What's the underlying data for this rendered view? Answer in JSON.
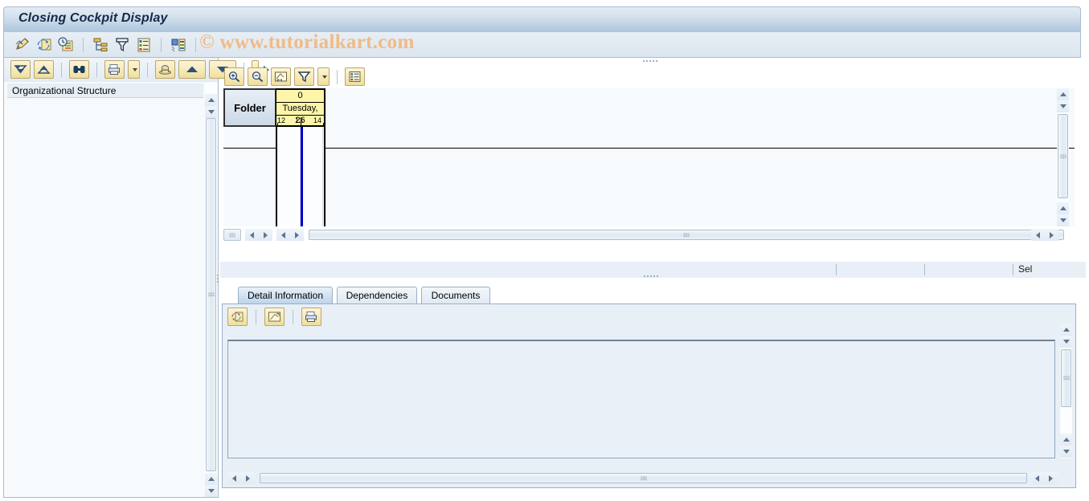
{
  "window": {
    "title": "Closing Cockpit Display"
  },
  "watermark": {
    "text": "© www.tutorialkart.com"
  },
  "main_toolbar": {
    "buttons": [
      {
        "name": "display-change-icon",
        "label": "Display/Change",
        "glyph": "pencil-ruler"
      },
      {
        "name": "refresh-icon",
        "label": "Refresh",
        "glyph": "refresh"
      },
      {
        "name": "schedule-icon",
        "label": "Schedule",
        "glyph": "clock-list"
      },
      {
        "name": "hierarchy-icon",
        "label": "Hierarchy",
        "glyph": "tree"
      },
      {
        "name": "filter-funnel-icon",
        "label": "Filter",
        "glyph": "funnel-box"
      },
      {
        "name": "detail-list-icon",
        "label": "Detail List",
        "glyph": "list"
      },
      {
        "name": "layout-icon",
        "label": "Layout",
        "glyph": "columns"
      }
    ]
  },
  "left_panel": {
    "toolbar": [
      {
        "name": "expand-all-button",
        "label": "Expand All",
        "glyph": "expand-down"
      },
      {
        "name": "collapse-all-button",
        "label": "Collapse All",
        "glyph": "collapse-up"
      },
      {
        "name": "find-button",
        "label": "Find",
        "glyph": "binoculars"
      },
      {
        "name": "print-button",
        "label": "Print",
        "glyph": "printer",
        "has_dropdown": true
      },
      {
        "name": "filter-button",
        "label": "Filter",
        "glyph": "hat"
      },
      {
        "name": "move-up-button",
        "label": "Move Up",
        "glyph": "up"
      },
      {
        "name": "move-down-button",
        "label": "Move Down",
        "glyph": "down"
      },
      {
        "name": "more-button",
        "label": "More",
        "glyph": "partial"
      }
    ],
    "tree_header": "Organizational Structure",
    "tree_items": []
  },
  "gantt": {
    "toolbar": [
      {
        "name": "zoom-in-button",
        "label": "Zoom In",
        "glyph": "zoom-in"
      },
      {
        "name": "zoom-out-button",
        "label": "Zoom Out",
        "glyph": "zoom-out"
      },
      {
        "name": "edit-chart-button",
        "label": "Edit",
        "glyph": "edit-pencil"
      },
      {
        "name": "filter-chart-button",
        "label": "Filter",
        "glyph": "funnel",
        "has_dropdown": true
      },
      {
        "name": "legend-button",
        "label": "Legend",
        "glyph": "list"
      }
    ],
    "folder_column_header": "Folder",
    "time_header": {
      "row1": "0",
      "row2": "Tuesday, 26",
      "ticks": [
        "12",
        "13",
        "14"
      ]
    },
    "now_marker_label": "current time"
  },
  "status_bar": {
    "selection_label": "Sel"
  },
  "tabs": [
    {
      "name": "tab-detail-information",
      "label": "Detail Information",
      "active": true
    },
    {
      "name": "tab-dependencies",
      "label": "Dependencies",
      "active": false
    },
    {
      "name": "tab-documents",
      "label": "Documents",
      "active": false
    }
  ],
  "detail_panel": {
    "toolbar": [
      {
        "name": "refresh-detail-button",
        "label": "Refresh",
        "glyph": "refresh"
      },
      {
        "name": "expand-detail-button",
        "label": "Expand",
        "glyph": "arrows"
      },
      {
        "name": "print-detail-button",
        "label": "Print",
        "glyph": "printer"
      }
    ],
    "content": ""
  },
  "colors": {
    "title_text": "#14284b",
    "watermark": "#f0bb85",
    "gantt_header_yellow": "#fdf6a8",
    "now_line": "#0000cc",
    "panel_bg": "#e8eff6",
    "button_gold": "#f6e9b6"
  }
}
